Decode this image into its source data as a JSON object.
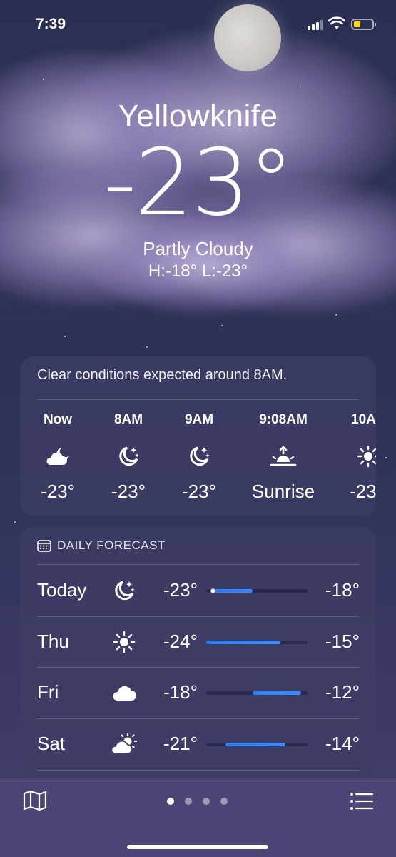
{
  "status_bar": {
    "time": "7:39"
  },
  "location": {
    "city": "Yellowknife",
    "temperature": "-23°",
    "condition": "Partly Cloudy",
    "high_low": "H:-18°  L:-23°"
  },
  "hourly": {
    "summary": "Clear conditions expected around 8AM.",
    "items": [
      {
        "label": "Now",
        "icon": "moon-cloud-icon",
        "value": "-23°"
      },
      {
        "label": "8AM",
        "icon": "moon-stars-icon",
        "value": "-23°"
      },
      {
        "label": "9AM",
        "icon": "moon-stars-icon",
        "value": "-23°"
      },
      {
        "label": "9:08AM",
        "icon": "sunrise-icon",
        "value": "Sunrise"
      },
      {
        "label": "10A",
        "icon": "sun-icon",
        "value": "-23"
      }
    ]
  },
  "daily": {
    "header": "DAILY FORECAST",
    "days": [
      {
        "name": "Today",
        "icon": "moon-stars-icon",
        "low": "-23°",
        "high": "-18°",
        "range_start": 0.06,
        "range_end": 0.46,
        "current": 0.06
      },
      {
        "name": "Thu",
        "icon": "sun-icon",
        "low": "-24°",
        "high": "-15°",
        "range_start": 0.0,
        "range_end": 0.73
      },
      {
        "name": "Fri",
        "icon": "cloud-icon",
        "low": "-18°",
        "high": "-12°",
        "range_start": 0.46,
        "range_end": 0.94
      },
      {
        "name": "Sat",
        "icon": "sun-cloud-icon",
        "low": "-21°",
        "high": "-14°",
        "range_start": 0.19,
        "range_end": 0.78
      }
    ]
  },
  "bottom_bar": {
    "pages": 4,
    "active_page": 0
  },
  "colors": {
    "accent_bar": "#2d7cf0",
    "battery": "#ffd60a"
  }
}
